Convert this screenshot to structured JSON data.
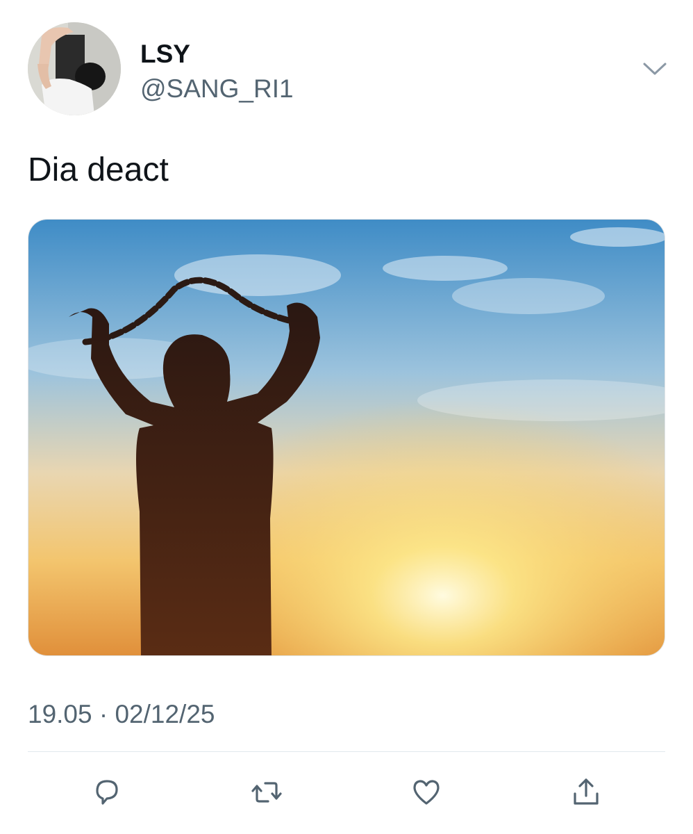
{
  "user": {
    "display_name": "LSY",
    "handle": "@SANG_RI1",
    "avatar_icon": "profile-photo"
  },
  "tweet": {
    "text": "Dia deact",
    "timestamp": "19.05 · 02/12/25"
  },
  "icons": {
    "menu": "chevron-down-icon",
    "reply": "reply-icon",
    "retweet": "retweet-icon",
    "like": "heart-icon",
    "share": "share-icon"
  },
  "colors": {
    "text": "#0f1419",
    "secondary_text": "#536471",
    "icon": "#536471",
    "divider": "#e1e8ed"
  }
}
